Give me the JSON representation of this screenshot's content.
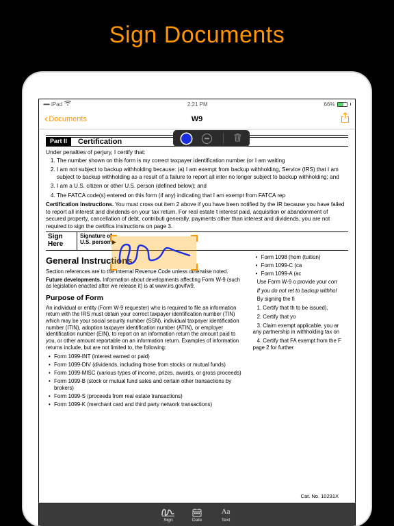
{
  "hero": {
    "title": "Sign Documents"
  },
  "status": {
    "carrier": "iPad",
    "time": "2:21 PM",
    "battery_pct": "66%"
  },
  "nav": {
    "back_label": "Documents",
    "title": "W9"
  },
  "color_toolbar": {
    "selected_color": "#1b2de0"
  },
  "doc": {
    "part_label": "Part II",
    "part_title": "Certification",
    "intro": "Under penalties of perjury, I certify that:",
    "items": [
      "The number shown on this form is my correct taxpayer identification number (or I am waiting",
      "I am not subject to backup withholding because: (a) I am exempt from backup withholding, Service (IRS) that I am subject to backup withholding as a result of a failure to report all inter no longer subject to backup withholding; and",
      "I am a U.S. citizen or other U.S. person (defined below); and",
      "The FATCA code(s) entered on this form (if any) indicating that I am exempt from FATCA rep"
    ],
    "cert_instr_label": "Certification instructions.",
    "cert_instr": " You must cross out item 2 above if you have been notified by the IR because you have failed to report all interest and dividends on your tax return. For real estate t interest paid, acquisition or abandonment of secured property, cancellation of debt, contributi generally, payments other than interest and dividends, you are not required to sign the certifica instructions on page 3.",
    "sign_here": "Sign Here",
    "sig_label_1": "Signature of",
    "sig_label_2": "U.S. person ▶",
    "gi_heading": "General Instructions",
    "gi_section_ref": "Section references are to the Internal Revenue Code unless otherwise noted.",
    "future_label": "Future developments.",
    "future_text": " Information about developments affecting Form W-9 (such as legislation enacted after we release it) is at www.irs.gov/fw9.",
    "purpose_heading": "Purpose of Form",
    "purpose_text": "An individual or entity (Form W-9 requester) who is required to file an information return with the IRS must obtain your correct taxpayer identification number (TIN) which may be your social security number (SSN), individual taxpayer identification number (ITIN), adoption taxpayer identification number (ATIN), or employer identification number (EIN), to report on an information return the amount paid to you, or other amount reportable on an information return. Examples of information returns include, but are not limited to, the following:",
    "bullets": [
      "Form 1099-INT (interest earned or paid)",
      "Form 1099-DIV (dividends, including those from stocks or mutual funds)",
      "Form 1099-MISC (various types of income, prizes, awards, or gross proceeds)",
      "Form 1099-B (stock or mutual fund sales and certain other transactions by brokers)",
      "Form 1099-S (proceeds from real estate transactions)",
      "Form 1099-K (merchant card and third party network transactions)"
    ],
    "right_bullets": [
      "Form 1098 (hom (tuition)",
      "Form 1099-C (ca",
      "Form 1099-A (ac"
    ],
    "right_paras": [
      "Use Form W-9 o provide your corr",
      "If you do not ret to backup withhol",
      "By signing the fi",
      "1. Certify that th to be issued),",
      "2. Certify that yo",
      "3. Claim exempt applicable, you ar any partnership in withholding tax on",
      "4. Certify that FA exempt from the F page 2 for further"
    ],
    "cat_no": "Cat. No. 10231X"
  },
  "bottom_toolbar": {
    "sign": "Sign",
    "date": "Date",
    "text": "Text"
  }
}
